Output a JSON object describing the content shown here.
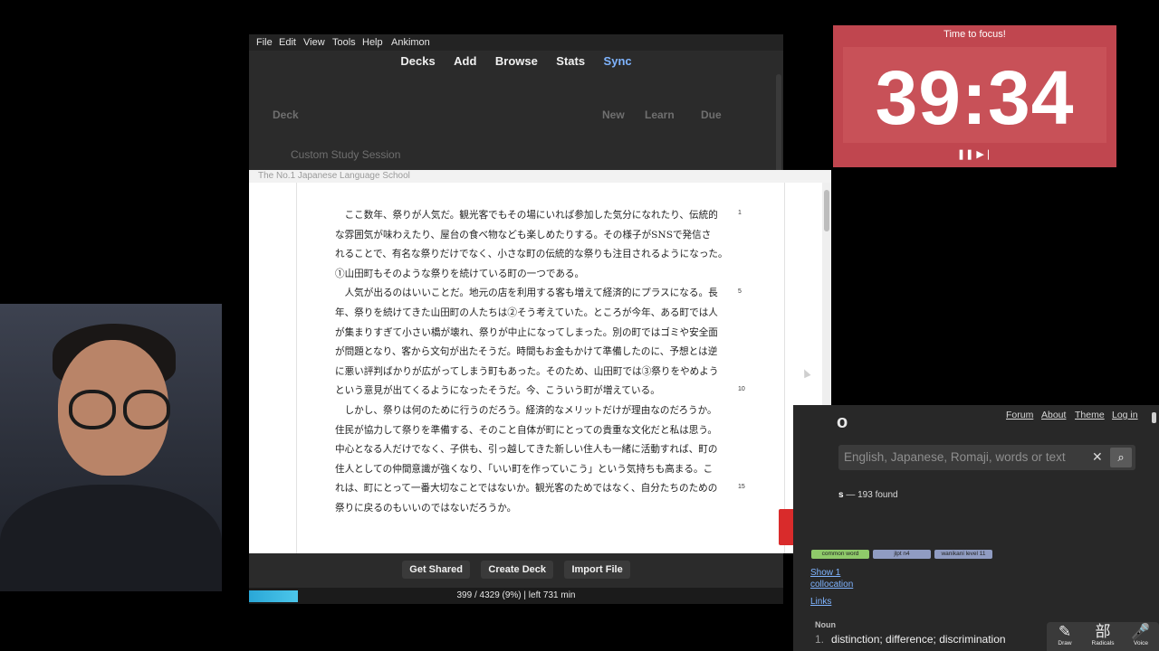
{
  "anki": {
    "menu": [
      "File",
      "Edit",
      "View",
      "Tools",
      "Help",
      "Ankimon"
    ],
    "toolbar": [
      "Decks",
      "Add",
      "Browse",
      "Stats",
      "Sync"
    ],
    "deck_headers": {
      "deck": "Deck",
      "new": "New",
      "learn": "Learn",
      "due": "Due"
    },
    "deck_row": "Custom Study Session",
    "bottom_buttons": [
      "Get Shared",
      "Create Deck",
      "Import File"
    ],
    "status_text": "399 / 4329 (9%) | left 731 min",
    "progress_fraction": 0.09
  },
  "reader": {
    "school_label": "The No.1 Japanese Language School",
    "lines": [
      "　ここ数年、祭りが人気だ。観光客でもその場にいれば参加した気分になれたり、伝統的",
      "な雰囲気が味わえたり、屋台の食べ物なども楽しめたりする。その様子がSNSで発信さ",
      "れることで、有名な祭りだけでなく、小さな町の伝統的な祭りも注目されるようになった。",
      "①山田町もそのような祭りを続けている町の一つである。",
      "　人気が出るのはいいことだ。地元の店を利用する客も増えて経済的にプラスになる。長",
      "年、祭りを続けてきた山田町の人たちは②そう考えていた。ところが今年、ある町では人",
      "が集まりすぎて小さい橋が壊れ、祭りが中止になってしまった。別の町ではゴミや安全面",
      "が問題となり、客から文句が出たそうだ。時間もお金もかけて準備したのに、予想とは逆",
      "に悪い評判ばかりが広がってしまう町もあった。そのため、山田町では③祭りをやめよう",
      "という意見が出てくるようになったそうだ。今、こういう町が増えている。",
      "　しかし、祭りは何のために行うのだろう。経済的なメリットだけが理由なのだろうか。",
      "住民が協力して祭りを準備する、そのこと自体が町にとっての貴重な文化だと私は思う。",
      "中心となる人だけでなく、子供も、引っ越してきた新しい住人も一緒に活動すれば、町の",
      "住人としての仲間意識が強くなり、「いい町を作っていこう」という気持ちも高まる。こ",
      "れは、町にとって一番大切なことではないか。観光客のためではなく、自分たちのための",
      "祭りに戻るのもいいのではないだろうか。"
    ],
    "line_numbers": [
      "1",
      "5",
      "10",
      "15"
    ],
    "to_top_icon": "chevron-up-icon"
  },
  "timer": {
    "label": "Time to focus!",
    "time": "39:34",
    "pause_icon": "pause-icon",
    "skip_icon": "skip-icon"
  },
  "jisho": {
    "nav": [
      "Forum",
      "About",
      "Theme",
      "Log in"
    ],
    "logo_fragment": "o",
    "search_placeholder": "English, Japanese, Romaji, words or text",
    "found_prefix": "s",
    "found_text": "— 193 found",
    "tags": [
      "common word",
      "jlpt n4",
      "wanikani level 11"
    ],
    "links": [
      "Show 1",
      "collocation",
      "Links"
    ],
    "pos": "Noun",
    "definition_num": "1.",
    "definition": "distinction; difference; discrimination",
    "tools": [
      {
        "glyph": "✎",
        "label": "Draw"
      },
      {
        "glyph": "部",
        "label": "Radicals"
      },
      {
        "glyph": "🎤",
        "label": "Voice"
      }
    ]
  },
  "colors": {
    "timer_bg": "#c0464f",
    "to_top_button": "#d92b2b",
    "sync_link": "#7fb4ff",
    "progress": "#2aa7d7"
  }
}
